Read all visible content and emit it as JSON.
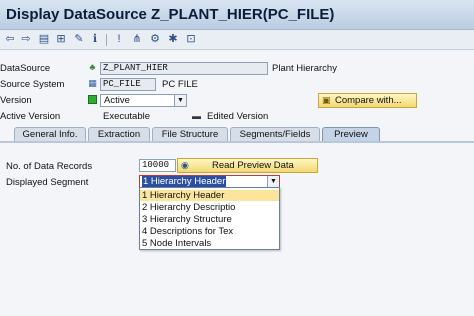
{
  "title_bar": {
    "title": "Display DataSource Z_PLANT_HIER(PC_FILE)"
  },
  "toolbar": {
    "icons": [
      "back-arrow-icon",
      "forward-arrow-icon",
      "other-object-icon",
      "hierarchy-icon",
      "display-change-icon",
      "info-icon",
      "tree-icon",
      "settings-icon",
      "transport-icon",
      "expand-icon"
    ]
  },
  "form": {
    "datasource": {
      "label": "DataSource",
      "value": "Z_PLANT_HIER",
      "desc": "Plant Hierarchy"
    },
    "source_system": {
      "label": "Source System",
      "value": "PC_FILE",
      "desc": "PC FILE"
    },
    "version": {
      "label": "Version",
      "value": "Active"
    },
    "active_version": {
      "label": "Active Version",
      "value": "Executable",
      "edited": "Edited Version"
    },
    "compare_button": "Compare with..."
  },
  "tabs": [
    {
      "label": "General Info."
    },
    {
      "label": "Extraction"
    },
    {
      "label": "File Structure"
    },
    {
      "label": "Segments/Fields"
    },
    {
      "label": "Preview",
      "active": true
    }
  ],
  "preview": {
    "records_label": "No. of Data Records",
    "records_value": "10000",
    "read_button": "Read Preview Data",
    "segment_label": "Displayed Segment",
    "segment_value": "1 Hierarchy Header",
    "segment_options": [
      "1 Hierarchy Header",
      "2 Hierarchy Descriptio",
      "3 Hierarchy Structure",
      "4 Descriptions for Tex",
      "5 Node Intervals"
    ]
  },
  "colors": {
    "active_green": "#2fae2f",
    "button_yellow": "#f2d873",
    "selection": "#fbe49b"
  }
}
